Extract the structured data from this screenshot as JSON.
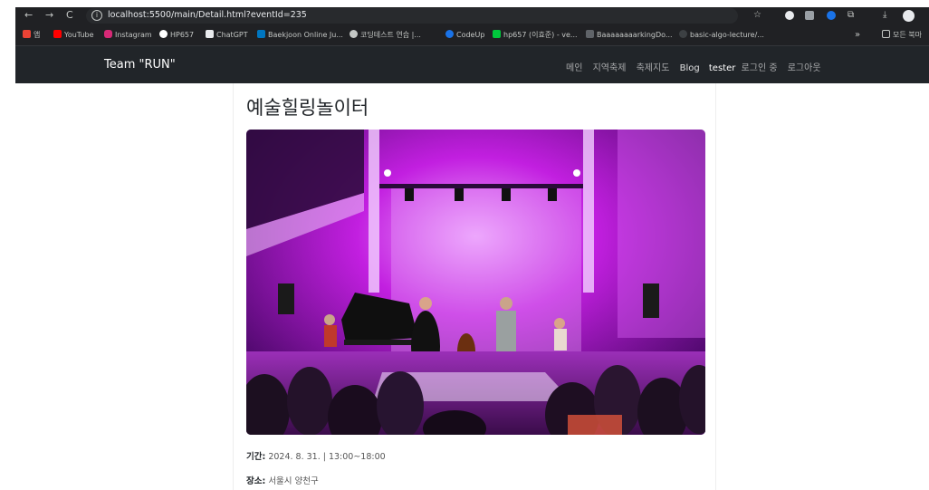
{
  "browser": {
    "url": "localhost:5500/main/Detail.html?eventId=235",
    "bookmarks": [
      {
        "label": "앱",
        "color": "#ea4335"
      },
      {
        "label": "YouTube",
        "color": "#ff0000"
      },
      {
        "label": "Instagram",
        "color": "#d62976"
      },
      {
        "label": "HP657",
        "color": "#ffffff"
      },
      {
        "label": "ChatGPT",
        "color": "#e8eaed"
      },
      {
        "label": "Baekjoon Online Ju...",
        "color": "#0076c0"
      },
      {
        "label": "코딩테스트 연습 |...",
        "color": "#c4c7c5"
      },
      {
        "label": "CodeUp",
        "color": "#1a73e8"
      },
      {
        "label": "hp657 (이효준) - ve...",
        "color": "#00c73c"
      },
      {
        "label": "BaaaaaaaarkingDo...",
        "color": "#5f6368"
      },
      {
        "label": "basic-algo-lecture/...",
        "color": "#3c4043"
      }
    ],
    "bookmarks_more": "»",
    "all_bookmarks": "모든 북마"
  },
  "site": {
    "brand": "Team \"RUN\"",
    "nav": {
      "main": "메인",
      "local_festival": "지역축제",
      "festival_map": "축제지도",
      "blog": "Blog",
      "user": "tester",
      "login_status": "로그인 중",
      "logout": "로그아웃"
    }
  },
  "event": {
    "title": "예술힐링놀이터",
    "period_label": "기간:",
    "period": "2024. 8. 31. | 13:00~18:00",
    "place_label": "장소:",
    "place": "서울시 양천구"
  },
  "colors": {
    "navbar": "#212529",
    "stage_magenta": "#c21fe0",
    "chrome": "#202124"
  }
}
